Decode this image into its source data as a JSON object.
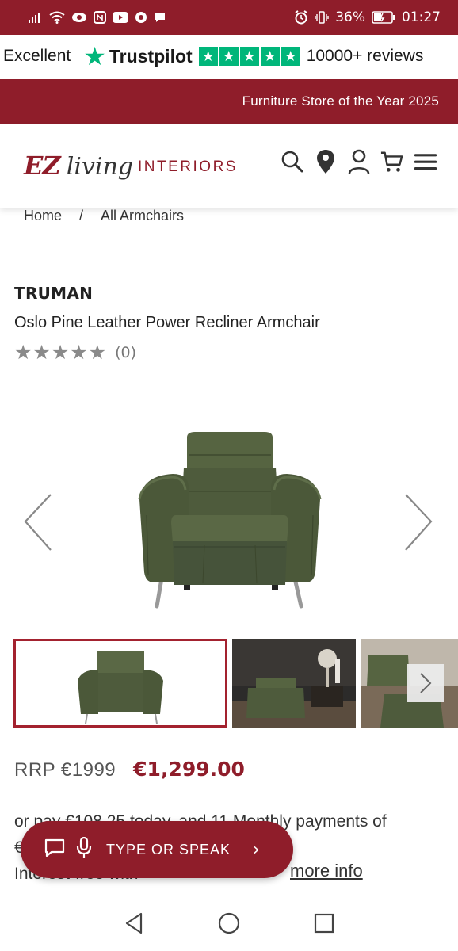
{
  "status_bar": {
    "battery": "36%",
    "time": "01:27"
  },
  "trustbar": {
    "rating_word": "Excellent",
    "brand": "Trustpilot",
    "reviews": "10000+ reviews"
  },
  "promo": {
    "text": "Furniture Store of the Year 2025"
  },
  "header": {
    "logo": {
      "ez": "EZ",
      "living": "living",
      "interiors": "INTERIORS"
    }
  },
  "breadcrumb": {
    "home": "Home",
    "separator": "/",
    "current": "All Armchairs"
  },
  "product": {
    "brand": "TRUMAN",
    "title": "Oslo Pine Leather Power Recliner Armchair",
    "rating_stars": 0,
    "review_count": "(0)",
    "rrp": "RRP €1999",
    "price": "€1,299.00",
    "finance_text": "or pay €108.25 today, and 11 Monthly payments of €108.25",
    "finance_prefix": "Interest-free with",
    "more_info": "more info"
  },
  "chat_widget": {
    "label": "TYPE OR SPEAK",
    "chevron": "›"
  },
  "colors": {
    "brand_red": "#8f1d2a",
    "trustpilot_green": "#00b67a",
    "chair_green": "#4e5b3c"
  },
  "icons": [
    "search-icon",
    "location-icon",
    "account-icon",
    "cart-icon",
    "menu-icon",
    "chat-icon",
    "microphone-icon"
  ]
}
